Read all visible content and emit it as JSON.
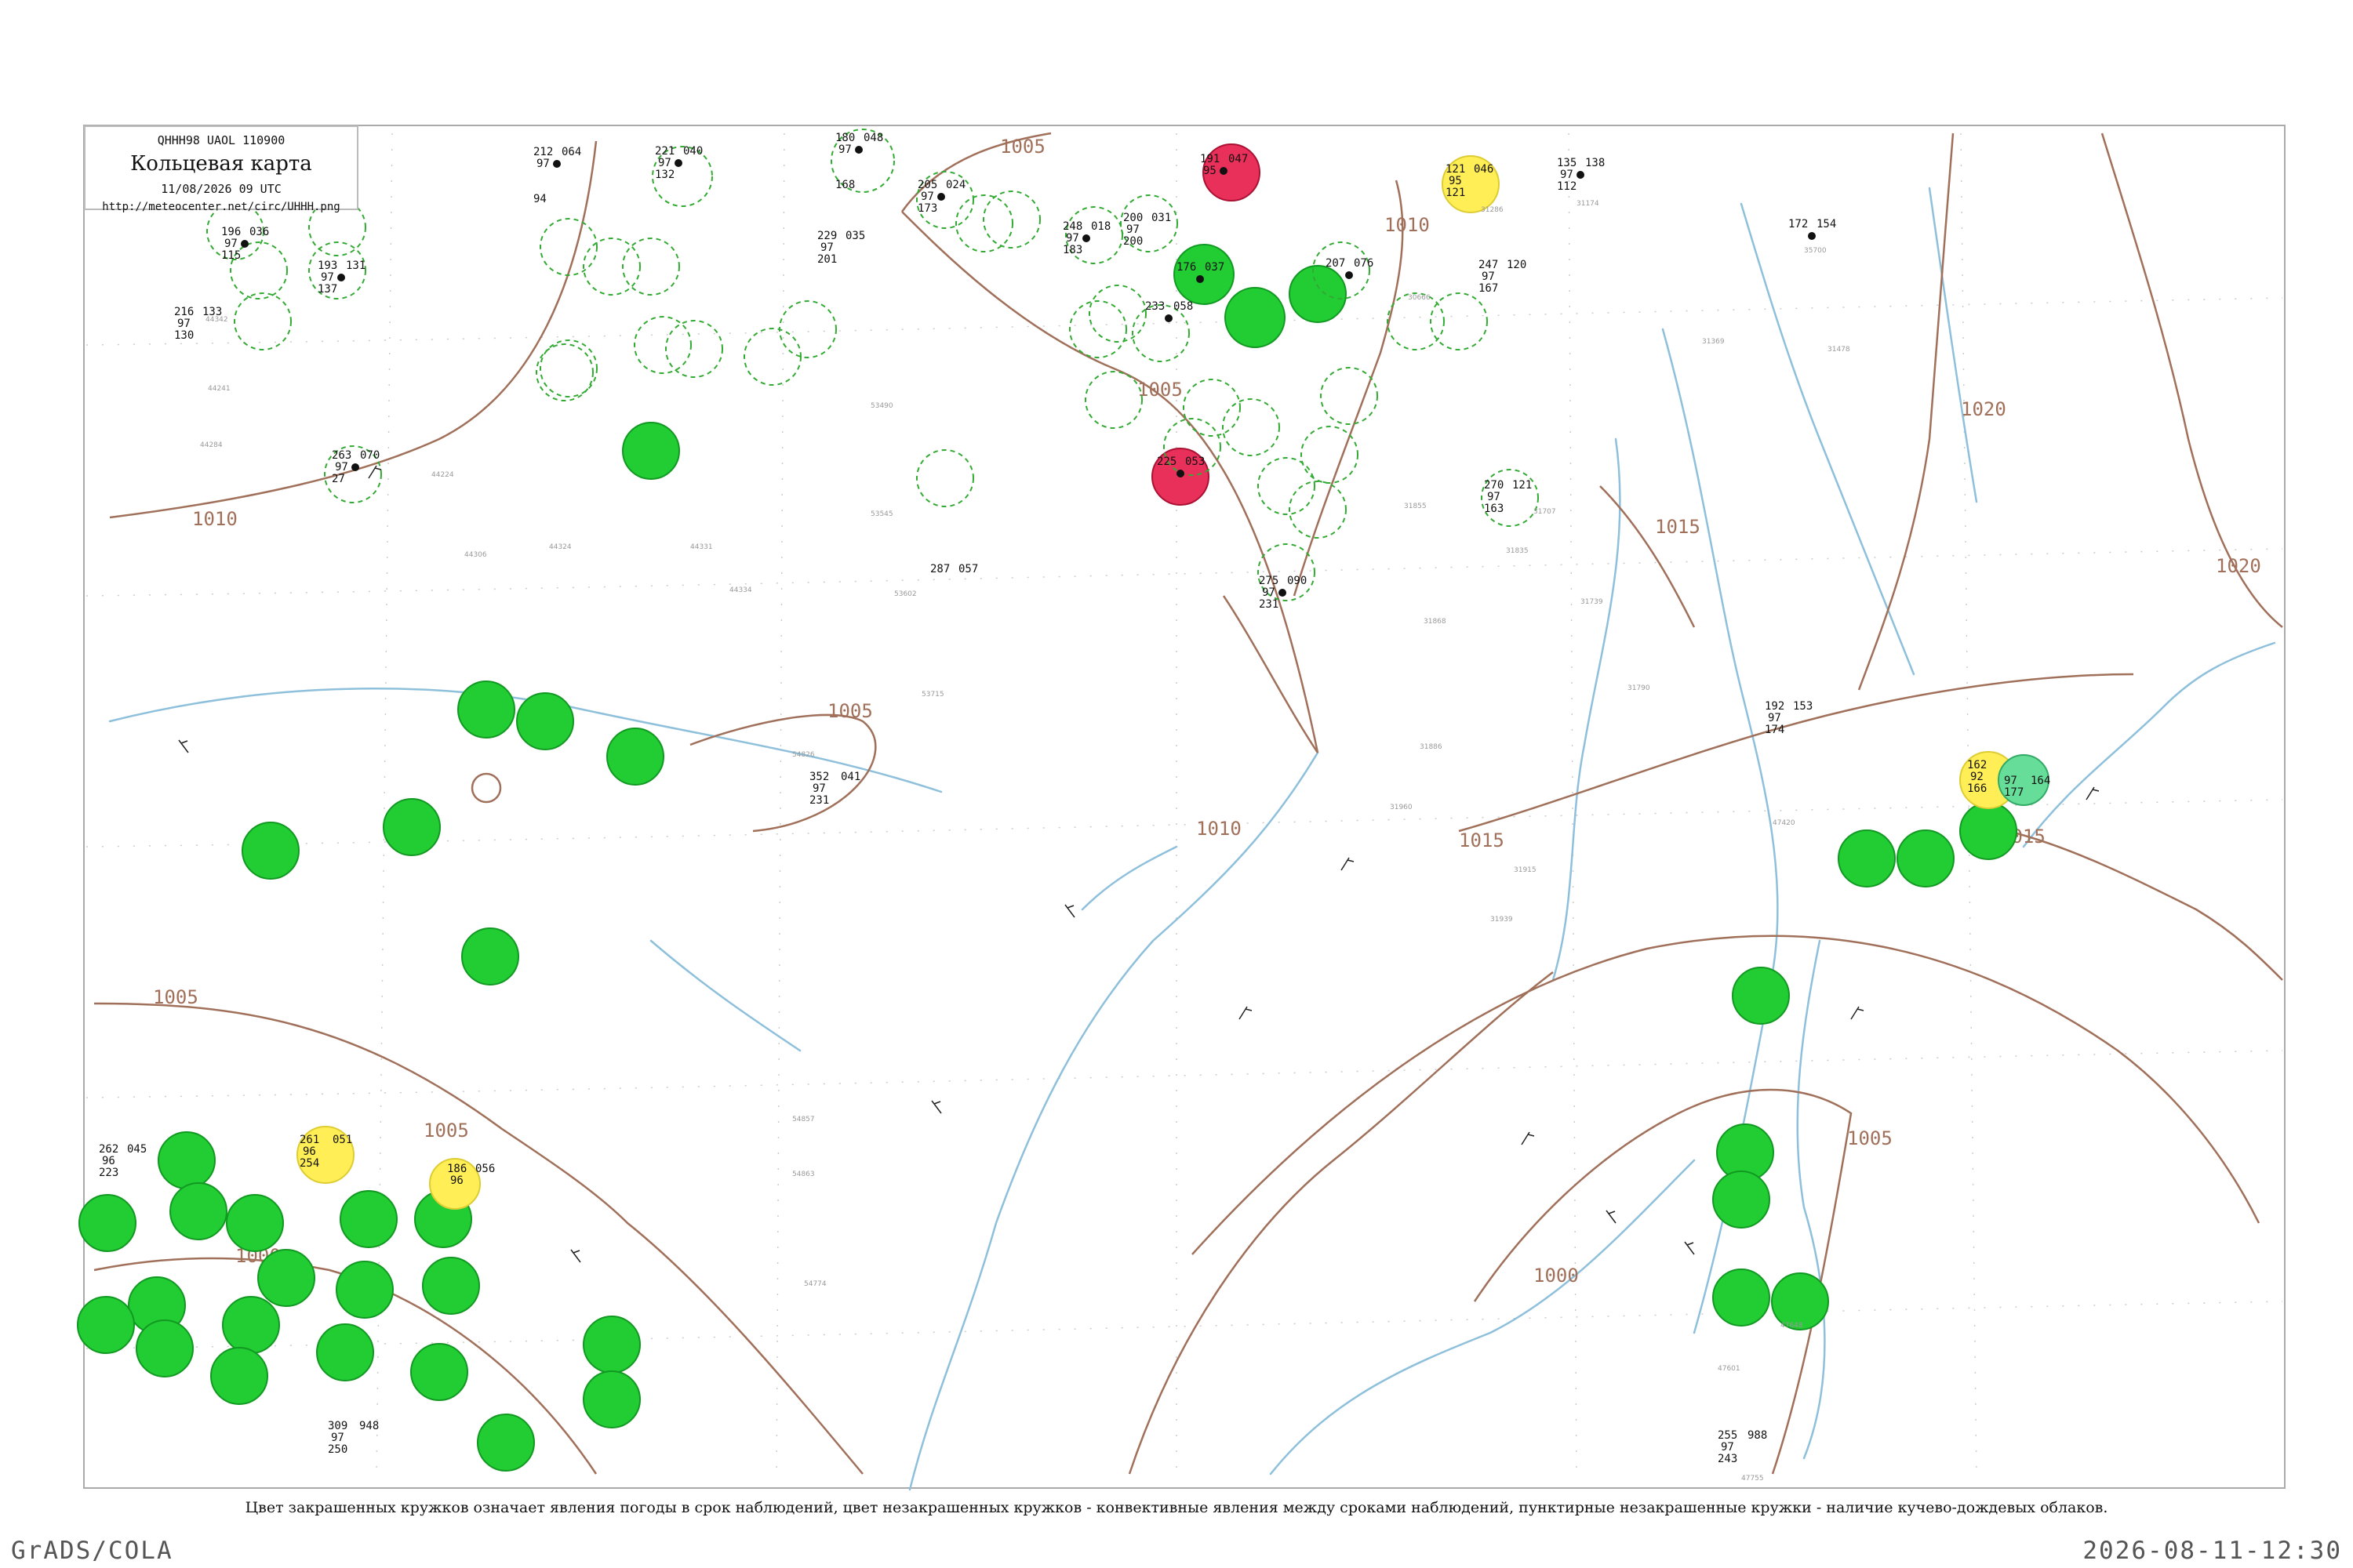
{
  "header": {
    "code": "QHHH98  UAOL  110900",
    "title": "Кольцевая карта",
    "datetime": "11/08/2026 09 UTC",
    "url": "http://meteocenter.net/circ/UHHH.png"
  },
  "caption": "Цвет закрашенных кружков означает явления погоды в срок наблюдений, цвет незакрашенных кружков - конвективные явления между сроками наблюдений, пунктирные незакрашенные кружки - наличие кучево-дождевых облаков.",
  "footer": {
    "credit": "GrADS/COLA",
    "timestamp": "2026-08-11-12:30"
  },
  "colors": {
    "isobar": "#a0705a",
    "river": "#8ec0dc",
    "frame": "#aaaaaa",
    "precip_fill": "#22cc33",
    "thunder_fill": "#e8305a",
    "fog_fill": "#ffee55",
    "light_fill": "#66dd99",
    "cb_dashed": "#33aa33"
  },
  "isobars": [
    {
      "label": "1000"
    },
    {
      "label": "1005"
    },
    {
      "label": "1010"
    },
    {
      "label": "1015"
    },
    {
      "label": "1020"
    }
  ],
  "stations": [
    {
      "t": "221",
      "p": "040",
      "w": "97",
      "c": "132",
      "kind": "cb"
    },
    {
      "t": "180",
      "p": "048",
      "w": "97",
      "c": "168",
      "kind": "cb"
    },
    {
      "t": "205",
      "p": "024",
      "w": "97",
      "c": "173",
      "kind": "cb"
    },
    {
      "t": "191",
      "p": "047",
      "w": "95",
      "c": "",
      "kind": "thunder"
    },
    {
      "t": "121",
      "p": "046",
      "w": "95",
      "c": "121",
      "kind": "fog"
    },
    {
      "t": "135",
      "p": "138",
      "w": "97",
      "c": "112",
      "kind": "plain"
    },
    {
      "t": "172",
      "p": "154",
      "w": "97",
      "c": "",
      "kind": "plain"
    },
    {
      "t": "212",
      "p": "064",
      "w": "97",
      "c": "94",
      "kind": "plain"
    },
    {
      "t": "196",
      "p": "036",
      "w": "97",
      "c": "115",
      "kind": "cb"
    },
    {
      "t": "193",
      "p": "131",
      "w": "97",
      "c": "137",
      "kind": "cb"
    },
    {
      "t": "216",
      "p": "133",
      "w": "97",
      "c": "130",
      "kind": "plain"
    },
    {
      "t": "233",
      "p": "058",
      "w": "97",
      "c": "",
      "kind": "plain"
    },
    {
      "t": "248",
      "p": "018",
      "w": "97",
      "c": "183",
      "kind": "cb"
    },
    {
      "t": "200",
      "p": "031",
      "w": "97",
      "c": "200",
      "kind": "cb"
    },
    {
      "t": "176",
      "p": "037",
      "w": "97",
      "c": "",
      "kind": "precip"
    },
    {
      "t": "229",
      "p": "035",
      "w": "97",
      "c": "201",
      "kind": "plain"
    },
    {
      "t": "207",
      "p": "076",
      "w": "97",
      "c": "",
      "kind": "cb"
    },
    {
      "t": "247",
      "p": "120",
      "w": "97",
      "c": "167",
      "kind": "plain"
    },
    {
      "t": "225",
      "p": "053",
      "w": "97",
      "c": "",
      "kind": "thunder"
    },
    {
      "t": "261",
      "p": "051",
      "w": "96",
      "c": "254",
      "kind": "fog"
    },
    {
      "t": "186",
      "p": "056",
      "w": "96",
      "c": "",
      "kind": "fog"
    },
    {
      "t": "162",
      "p": "164",
      "w": "92",
      "c": "166",
      "kind": "fog"
    },
    {
      "t": "177",
      "p": "164",
      "w": "97",
      "c": "",
      "kind": "light"
    },
    {
      "t": "263",
      "p": "070",
      "w": "97",
      "c": "27",
      "kind": "cb"
    },
    {
      "t": "275",
      "p": "090",
      "w": "97",
      "c": "231",
      "kind": "cb"
    },
    {
      "t": "270",
      "p": "121",
      "w": "97",
      "c": "163",
      "kind": "cb"
    },
    {
      "t": "262",
      "p": "045",
      "w": "96",
      "c": "223",
      "kind": "plain"
    },
    {
      "t": "309",
      "p": "948",
      "w": "97",
      "c": "250",
      "kind": "plain"
    },
    {
      "t": "287",
      "p": "057",
      "w": "97",
      "c": "",
      "kind": "plain"
    },
    {
      "t": "352",
      "p": "041",
      "w": "97",
      "c": "231",
      "kind": "plain"
    },
    {
      "t": "255",
      "p": "988",
      "w": "97",
      "c": "243",
      "kind": "plain"
    },
    {
      "t": "192",
      "p": "153",
      "w": "97",
      "c": "174",
      "kind": "plain"
    }
  ],
  "station_ids": [
    "31286",
    "31174",
    "35700",
    "31369",
    "31478",
    "30666",
    "44342",
    "44241",
    "44284",
    "44224",
    "44324",
    "44306",
    "44334",
    "44331",
    "53545",
    "53490",
    "53602",
    "53715",
    "54826",
    "54857",
    "54863",
    "54774",
    "47648",
    "47601",
    "47755",
    "47420",
    "31960",
    "31939",
    "31915",
    "31886",
    "31868",
    "31835",
    "31855",
    "31739",
    "31707",
    "31790"
  ]
}
